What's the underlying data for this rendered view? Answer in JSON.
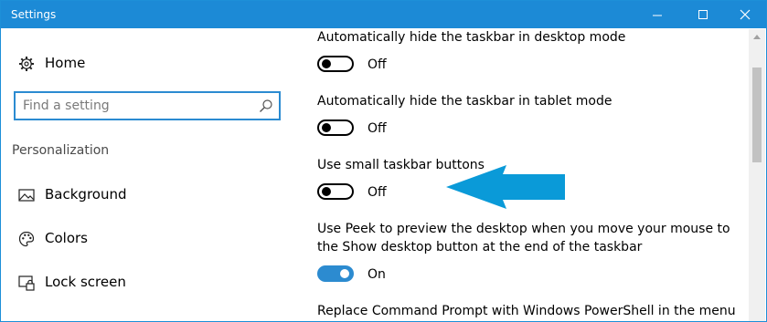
{
  "window": {
    "title": "Settings"
  },
  "sidebar": {
    "home": {
      "label": "Home",
      "icon": "gear-icon"
    },
    "search": {
      "placeholder": "Find a setting",
      "icon": "search-icon"
    },
    "section_title": "Personalization",
    "items": [
      {
        "label": "Background",
        "icon": "image-icon"
      },
      {
        "label": "Colors",
        "icon": "palette-icon"
      },
      {
        "label": "Lock screen",
        "icon": "lock-screen-icon"
      }
    ]
  },
  "settings": [
    {
      "title": "Automatically hide the taskbar in desktop mode",
      "state": "Off",
      "on": false
    },
    {
      "title": "Automatically hide the taskbar in tablet mode",
      "state": "Off",
      "on": false
    },
    {
      "title": "Use small taskbar buttons",
      "state": "Off",
      "on": false
    },
    {
      "title_line1": "Use Peek to preview the desktop when you move your mouse to",
      "title_line2": "the Show desktop button at the end of the taskbar",
      "state": "On",
      "on": true
    },
    {
      "title": "Replace Command Prompt with Windows PowerShell in the menu"
    }
  ],
  "colors": {
    "accent": "#2c8bd0",
    "titlebar": "#1c8ad6",
    "arrow": "#0a9ad8"
  }
}
